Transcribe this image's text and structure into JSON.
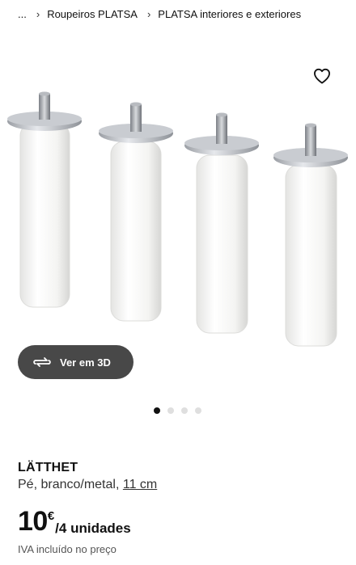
{
  "breadcrumb": {
    "ellipsis": "...",
    "items": [
      {
        "label": "Roupeiros PLATSA"
      },
      {
        "label": "PLATSA interiores e exteriores"
      }
    ]
  },
  "gallery": {
    "button_3d_label": "Ver em 3D",
    "dots_count": 4,
    "active_dot": 1,
    "image_icon": "product-photo-legs"
  },
  "product": {
    "name": "LÄTTHET",
    "description": "Pé, branco/metal,",
    "size": "11 cm",
    "price_amount": "10",
    "price_currency": "€",
    "price_unit": "/4 unidades",
    "tax_note": "IVA incluído no preço"
  },
  "colors": {
    "button_bg": "#484848",
    "dot_active": "#111111",
    "dot_inactive": "#dfdfdf"
  }
}
